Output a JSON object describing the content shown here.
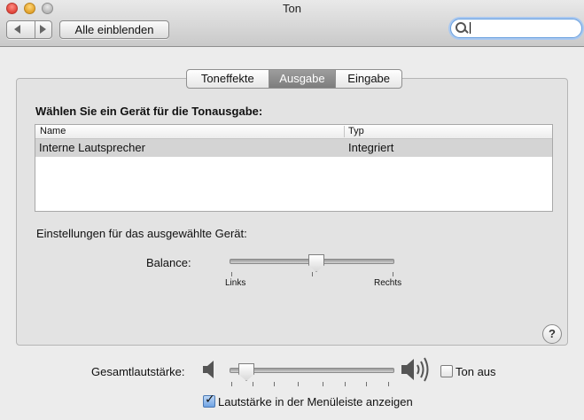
{
  "window": {
    "title": "Ton"
  },
  "toolbar": {
    "back_icon": "chevron-left-icon",
    "forward_icon": "chevron-right-icon",
    "show_all_label": "Alle einblenden",
    "search": {
      "value": "",
      "icon": "search-icon"
    }
  },
  "tabs": [
    {
      "label": "Toneffekte",
      "selected": false
    },
    {
      "label": "Ausgabe",
      "selected": true
    },
    {
      "label": "Eingabe",
      "selected": false
    }
  ],
  "output": {
    "heading": "Wählen Sie ein Gerät für die Tonausgabe:",
    "table": {
      "columns": [
        "Name",
        "Typ"
      ],
      "rows": [
        {
          "name": "Interne Lautsprecher",
          "type": "Integriert",
          "selected": true
        }
      ]
    },
    "settings_label": "Einstellungen für das ausgewählte Gerät:",
    "balance": {
      "label": "Balance:",
      "left_label": "Links",
      "right_label": "Rechts",
      "value": 0.5
    },
    "help_label": "?"
  },
  "volume": {
    "label": "Gesamtlautstärke:",
    "value": 0.1,
    "low_icon": "speaker-low-icon",
    "high_icon": "speaker-high-icon",
    "mute_label": "Ton aus",
    "mute_checked": false
  },
  "menubar": {
    "label": "Lautstärke in der Menüleiste anzeigen",
    "checked": true
  },
  "colors": {
    "selected_tab": "#8a8a8a",
    "selected_row": "#d4d4d4",
    "search_focus": "#6aa0de"
  }
}
